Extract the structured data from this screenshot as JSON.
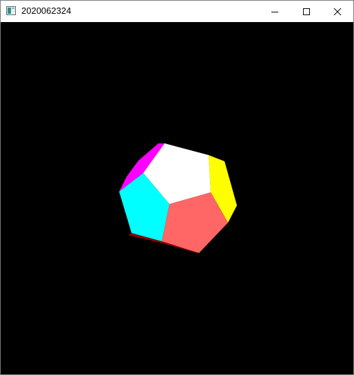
{
  "window": {
    "title": "2020062324",
    "controls": [
      "minimize",
      "maximize",
      "close"
    ]
  },
  "icons": {
    "app": "app-window-icon",
    "minimize": "minimize-icon",
    "maximize": "maximize-icon",
    "close": "close-icon"
  },
  "viewport": {
    "background": "#000000",
    "object": "dodecahedron",
    "face_colors": {
      "top": "#ffffff",
      "front_right": "#ff6666",
      "left": "#00ffff",
      "right": "#ffff00",
      "upper_left": "#ff00ff",
      "bottom_edge": "#8b0000"
    }
  }
}
